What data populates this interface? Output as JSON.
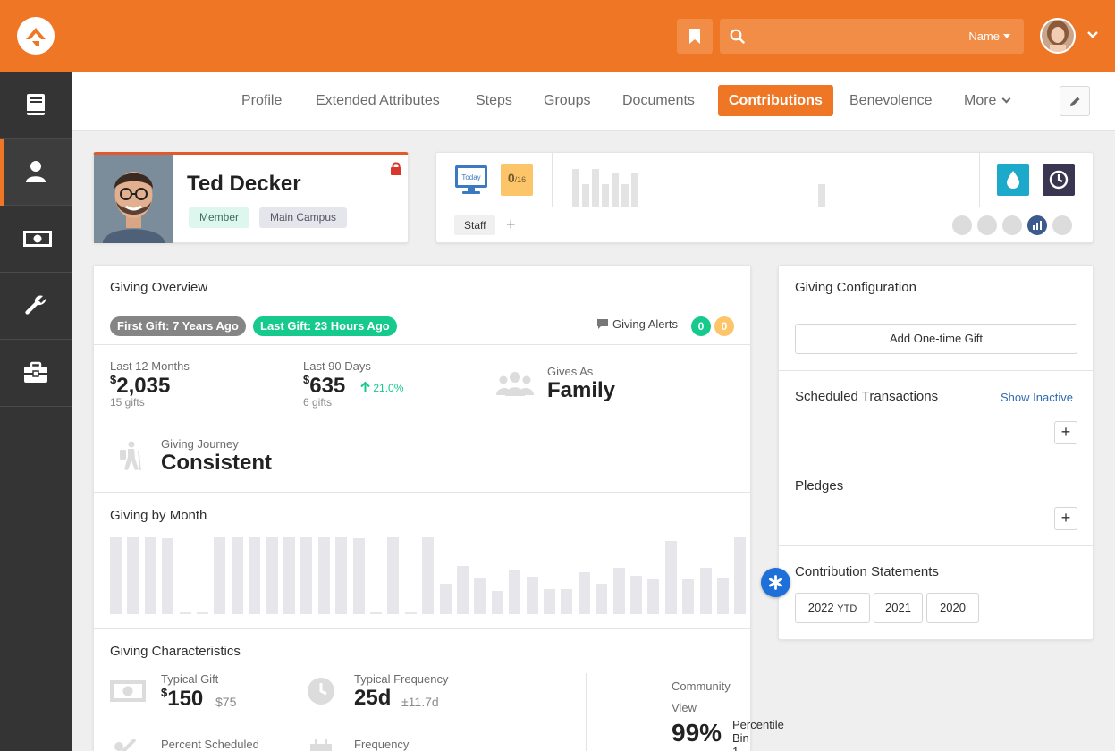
{
  "header": {
    "search_placeholder": "",
    "search_type": "Name"
  },
  "tabs": [
    {
      "label": "Profile"
    },
    {
      "label": "Extended Attributes"
    },
    {
      "label": "Steps"
    },
    {
      "label": "Groups"
    },
    {
      "label": "Documents"
    },
    {
      "label": "Contributions"
    },
    {
      "label": "Benevolence"
    },
    {
      "label": "More"
    }
  ],
  "active_tab": "Contributions",
  "colors": {
    "brand": "#ee7624",
    "sidebar": "#343434",
    "success": "#16c98d",
    "warning": "#fcc56a"
  },
  "person": {
    "name": "Ted Decker",
    "badges": [
      "Member",
      "Main Campus"
    ]
  },
  "badge_bar": {
    "today_label": "Today",
    "attendance_count": "0",
    "attendance_total": "/16",
    "tags": [
      "Staff"
    ],
    "add_tag": "+"
  },
  "giving_overview": {
    "title": "Giving Overview",
    "first_gift": "First Gift: 7 Years Ago",
    "last_gift": "Last Gift: 23 Hours Ago",
    "alerts_label": "Giving Alerts",
    "alerts_green": "0",
    "alerts_yellow": "0",
    "last12_label": "Last 12 Months",
    "last12_currency": "$",
    "last12_value": "2,035",
    "last12_sub": "15 gifts",
    "last90_label": "Last 90 Days",
    "last90_currency": "$",
    "last90_value": "635",
    "last90_change": "21.0%",
    "last90_sub": "6 gifts",
    "gives_as_label": "Gives As",
    "gives_as_value": "Family",
    "journey_label": "Giving Journey",
    "journey_value": "Consistent",
    "by_month_title": "Giving by Month",
    "characteristics_title": "Giving Characteristics",
    "typical_gift_label": "Typical Gift",
    "typical_gift_currency": "$",
    "typical_gift_value": "150",
    "typical_gift_sub": "$75",
    "typical_freq_label": "Typical Frequency",
    "typical_freq_value": "25d",
    "typical_freq_sub": "±11.7d",
    "community_label": "Community",
    "community_view": "View",
    "community_value": "99%",
    "percentile_label": "Percentile",
    "bin_label": "Bin 1",
    "percent_scheduled_label": "Percent Scheduled",
    "frequency_label": "Frequency"
  },
  "giving_by_month": {
    "relative_values": [
      1,
      1,
      1,
      0.99,
      0.02,
      0.02,
      1,
      1,
      1,
      1,
      1,
      1,
      1,
      1,
      0.99,
      0.02,
      1,
      0.02,
      1,
      0.4,
      0.63,
      0.48,
      0.3,
      0.57,
      0.49,
      0.33,
      0.32,
      0.55,
      0.4,
      0.6,
      0.5,
      0.45,
      0.95,
      0.45,
      0.6,
      0.47,
      1
    ]
  },
  "giving_configuration": {
    "title": "Giving Configuration",
    "one_time_gift": "Add One-time Gift",
    "scheduled_title": "Scheduled Transactions",
    "show_inactive": "Show Inactive",
    "pledges_title": "Pledges",
    "statements_title": "Contribution Statements",
    "statements": [
      {
        "year": "2022",
        "suffix": "YTD"
      },
      {
        "year": "2021",
        "suffix": ""
      },
      {
        "year": "2020",
        "suffix": ""
      }
    ],
    "plus": "+"
  }
}
